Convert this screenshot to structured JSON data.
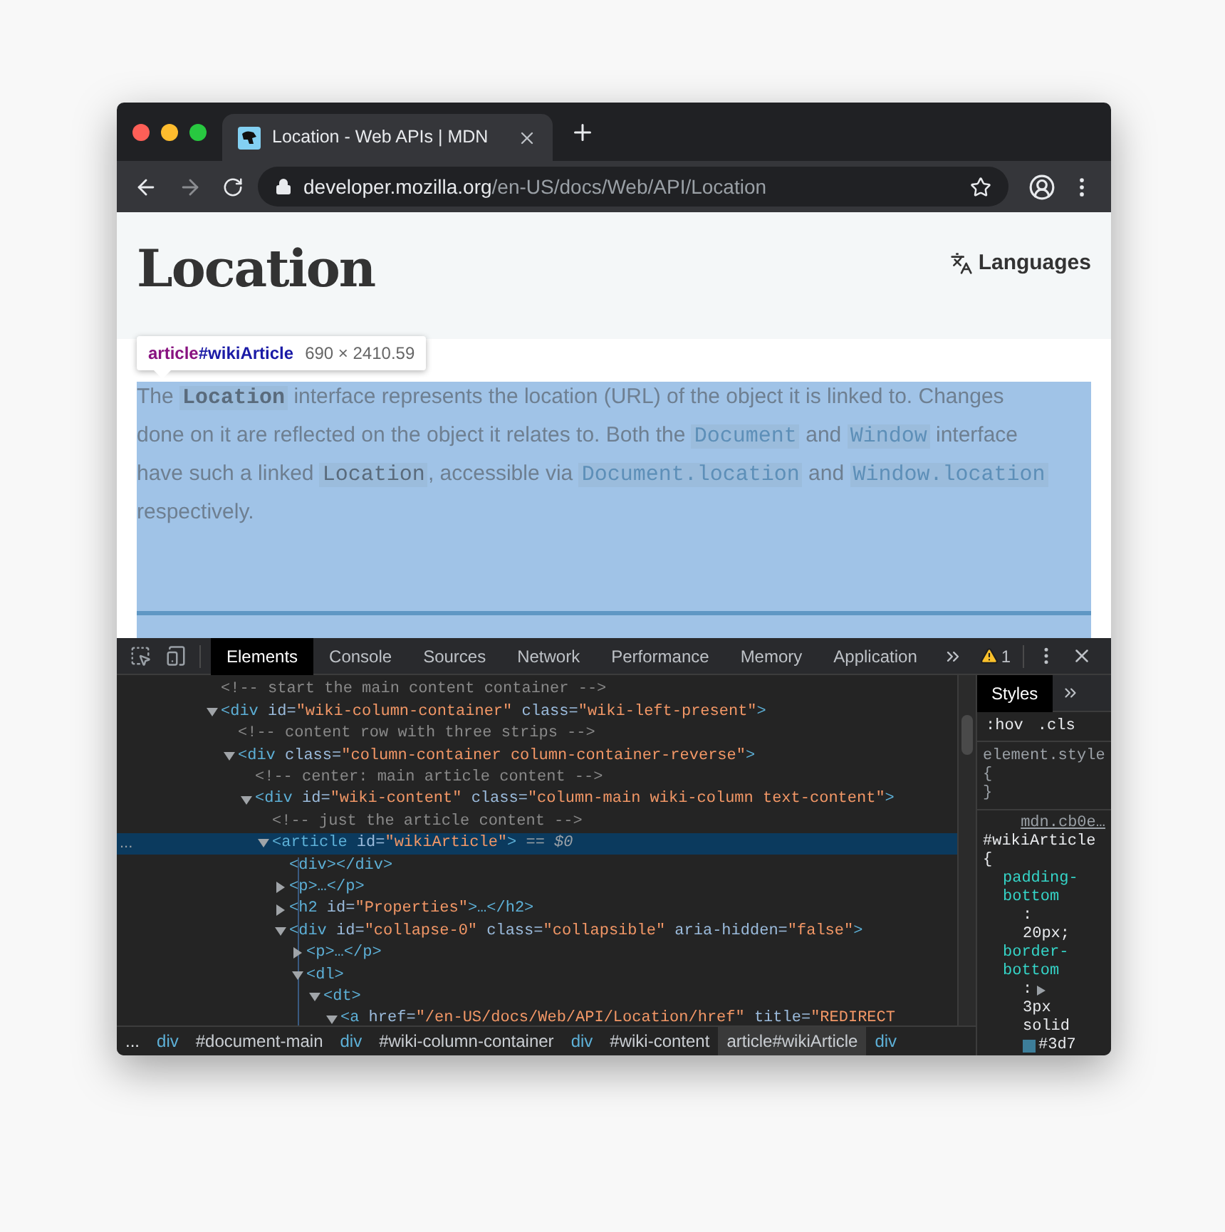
{
  "browser": {
    "tab": {
      "title": "Location - Web APIs | MDN",
      "selected": true
    },
    "address": {
      "host": "developer.mozilla.org",
      "path": "/en-US/docs/Web/API/Location"
    }
  },
  "page": {
    "heading": "Location",
    "languages": "Languages",
    "tooltip": {
      "tag": "article",
      "id": "#wikiArticle",
      "size": "690 × 2410.59"
    },
    "paragraph": [
      {
        "kind": "text",
        "text": "The "
      },
      {
        "kind": "code_bold",
        "text": "Location"
      },
      {
        "kind": "text",
        "text": " interface represents the location (URL) of the object it is linked to. Changes done on it are reflected on the object it relates to. Both the "
      },
      {
        "kind": "code_link",
        "text": "Document"
      },
      {
        "kind": "text",
        "text": " and "
      },
      {
        "kind": "code_link",
        "text": "Window"
      },
      {
        "kind": "text",
        "text": " interface have such a linked "
      },
      {
        "kind": "code",
        "text": "Location"
      },
      {
        "kind": "text",
        "text": ", accessible via "
      },
      {
        "kind": "code_link",
        "text": "Document.location"
      },
      {
        "kind": "text",
        "text": " and "
      },
      {
        "kind": "code_link",
        "text": "Window.location"
      },
      {
        "kind": "text",
        "text": " respectively."
      }
    ]
  },
  "devtools": {
    "tabs": [
      {
        "label": "Elements",
        "selected": true
      },
      {
        "label": "Console",
        "selected": false
      },
      {
        "label": "Sources",
        "selected": false
      },
      {
        "label": "Network",
        "selected": false
      },
      {
        "label": "Performance",
        "selected": false
      },
      {
        "label": "Memory",
        "selected": false
      },
      {
        "label": "Application",
        "selected": false
      }
    ],
    "warnings": "1",
    "dom": [
      {
        "kind": "comment",
        "selected": false,
        "tokens": [
          {
            "kind": "comment",
            "text": "<!-- start the main content container -->"
          }
        ]
      },
      {
        "kind": "element",
        "expanded": true,
        "selected": false,
        "tokens": [
          {
            "kind": "tag",
            "text": "<div"
          },
          {
            "kind": "attr",
            "text": " id="
          },
          {
            "kind": "value",
            "text": "\"wiki-column-container\""
          },
          {
            "kind": "attr",
            "text": " class="
          },
          {
            "kind": "value",
            "text": "\"wiki-left-present\""
          },
          {
            "kind": "tag",
            "text": ">"
          }
        ],
        "children": [
          {
            "kind": "comment",
            "selected": false,
            "tokens": [
              {
                "kind": "comment",
                "text": "<!-- content row with three strips -->"
              }
            ]
          },
          {
            "kind": "element",
            "expanded": true,
            "selected": false,
            "tokens": [
              {
                "kind": "tag",
                "text": "<div"
              },
              {
                "kind": "attr",
                "text": " class="
              },
              {
                "kind": "value",
                "text": "\"column-container column-container-reverse\""
              },
              {
                "kind": "tag",
                "text": ">"
              }
            ],
            "children": [
              {
                "kind": "comment",
                "selected": false,
                "tokens": [
                  {
                    "kind": "comment",
                    "text": "<!-- center: main article content -->"
                  }
                ]
              },
              {
                "kind": "element",
                "expanded": true,
                "selected": false,
                "tokens": [
                  {
                    "kind": "tag",
                    "text": "<div"
                  },
                  {
                    "kind": "attr",
                    "text": " id="
                  },
                  {
                    "kind": "value",
                    "text": "\"wiki-content\""
                  },
                  {
                    "kind": "attr",
                    "text": " class="
                  },
                  {
                    "kind": "value",
                    "text": "\"column-main wiki-column text-content\""
                  },
                  {
                    "kind": "tag",
                    "text": ">"
                  }
                ],
                "children": [
                  {
                    "kind": "comment",
                    "selected": false,
                    "tokens": [
                      {
                        "kind": "comment",
                        "text": "<!-- just the article content -->"
                      }
                    ]
                  },
                  {
                    "kind": "element",
                    "expanded": true,
                    "selected": true,
                    "marker": "...",
                    "tokens": [
                      {
                        "kind": "tag",
                        "text": "<article"
                      },
                      {
                        "kind": "attr",
                        "text": " id="
                      },
                      {
                        "kind": "value",
                        "text": "\"wikiArticle\""
                      },
                      {
                        "kind": "tag",
                        "text": ">"
                      },
                      {
                        "kind": "ref",
                        "text": " == $0"
                      }
                    ],
                    "children": [
                      {
                        "kind": "leaf",
                        "selected": false,
                        "tokens": [
                          {
                            "kind": "tag",
                            "text": "<div></div>"
                          }
                        ]
                      },
                      {
                        "kind": "element",
                        "expanded": false,
                        "selected": false,
                        "tokens": [
                          {
                            "kind": "tag",
                            "text": "<p>…</p>"
                          }
                        ]
                      },
                      {
                        "kind": "element",
                        "expanded": false,
                        "selected": false,
                        "tokens": [
                          {
                            "kind": "tag",
                            "text": "<h2"
                          },
                          {
                            "kind": "attr",
                            "text": " id="
                          },
                          {
                            "kind": "value",
                            "text": "\"Properties\""
                          },
                          {
                            "kind": "tag",
                            "text": ">…</h2>"
                          }
                        ]
                      },
                      {
                        "kind": "element",
                        "expanded": true,
                        "selected": false,
                        "tokens": [
                          {
                            "kind": "tag",
                            "text": "<div"
                          },
                          {
                            "kind": "attr",
                            "text": " id="
                          },
                          {
                            "kind": "value",
                            "text": "\"collapse-0\""
                          },
                          {
                            "kind": "attr",
                            "text": " class="
                          },
                          {
                            "kind": "value",
                            "text": "\"collapsible\""
                          },
                          {
                            "kind": "attr",
                            "text": " aria-hidden="
                          },
                          {
                            "kind": "value",
                            "text": "\"false\""
                          },
                          {
                            "kind": "tag",
                            "text": ">"
                          }
                        ],
                        "children": [
                          {
                            "kind": "element",
                            "expanded": false,
                            "selected": false,
                            "tokens": [
                              {
                                "kind": "tag",
                                "text": "<p>…</p>"
                              }
                            ]
                          },
                          {
                            "kind": "element",
                            "expanded": true,
                            "selected": false,
                            "tokens": [
                              {
                                "kind": "tag",
                                "text": "<dl>"
                              }
                            ],
                            "children": [
                              {
                                "kind": "element",
                                "expanded": true,
                                "selected": false,
                                "tokens": [
                                  {
                                    "kind": "tag",
                                    "text": "<dt>"
                                  }
                                ],
                                "children": [
                                  {
                                    "kind": "element",
                                    "expanded": true,
                                    "selected": false,
                                    "tokens": [
                                      {
                                        "kind": "tag",
                                        "text": "<a"
                                      },
                                      {
                                        "kind": "attr",
                                        "text": " href="
                                      },
                                      {
                                        "kind": "value",
                                        "text": "\"/en-US/docs/Web/API/Location/href\""
                                      },
                                      {
                                        "kind": "attr",
                                        "text": " title="
                                      },
                                      {
                                        "kind": "value",
                                        "text": "\"REDIRECT"
                                      }
                                    ]
                                  }
                                ]
                              }
                            ]
                          }
                        ]
                      }
                    ]
                  }
                ]
              }
            ]
          }
        ]
      }
    ],
    "breadcrumbs": [
      {
        "kind": "more",
        "text": "...",
        "selected": false
      },
      {
        "kind": "tag",
        "text": "div",
        "selected": false
      },
      {
        "kind": "id",
        "text": "#document-main",
        "selected": false
      },
      {
        "kind": "tag",
        "text": "div",
        "selected": false
      },
      {
        "kind": "id",
        "text": "#wiki-column-container",
        "selected": false
      },
      {
        "kind": "tag",
        "text": "div",
        "selected": false
      },
      {
        "kind": "id",
        "text": "#wiki-content",
        "selected": false
      },
      {
        "kind": "id",
        "text": "article#wikiArticle",
        "selected": true
      },
      {
        "kind": "tag",
        "text": "div",
        "selected": false
      }
    ],
    "styles": {
      "tabs": [
        {
          "label": "Styles",
          "selected": true
        }
      ],
      "filters": [
        ":hov",
        ".cls"
      ],
      "element_style": {
        "selector": "element.style {",
        "close": "}"
      },
      "rule": {
        "source": "mdn.cb0e…",
        "selector": "#wikiArticle {",
        "declarations": [
          {
            "property": "padding-bottom",
            "separator": ":",
            "value": "20px;"
          },
          {
            "property": "border-bottom",
            "separator": ":",
            "value": "3px solid",
            "expandable": true,
            "color": "#3d7e9a",
            "swatch_text": "#3d7"
          }
        ]
      }
    }
  }
}
